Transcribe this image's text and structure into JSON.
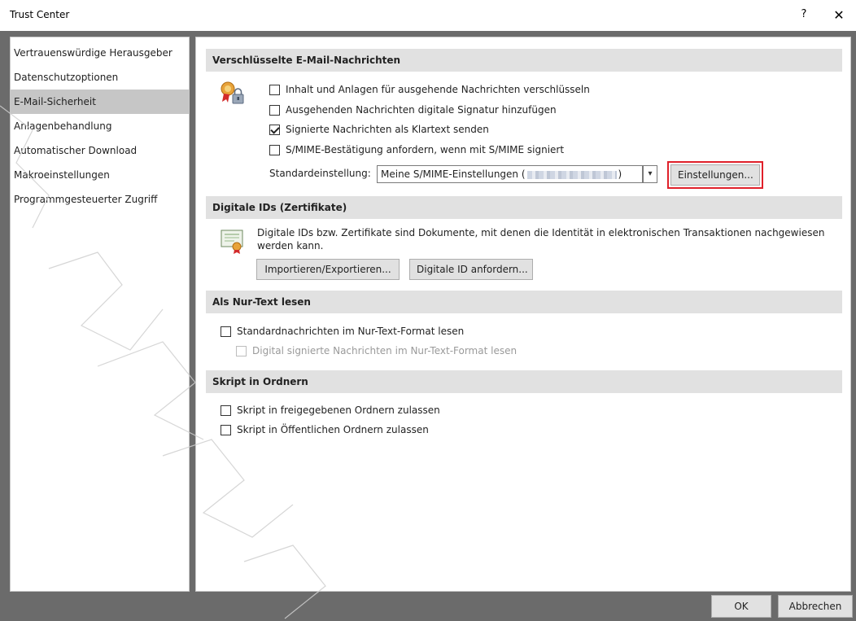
{
  "window": {
    "title": "Trust Center",
    "help_glyph": "?",
    "close_glyph": "✕"
  },
  "sidebar": {
    "items": [
      {
        "label": "Vertrauenswürdige Herausgeber",
        "selected": false
      },
      {
        "label": "Datenschutzoptionen",
        "selected": false
      },
      {
        "label": "E-Mail-Sicherheit",
        "selected": true
      },
      {
        "label": "Anlagenbehandlung",
        "selected": false
      },
      {
        "label": "Automatischer Download",
        "selected": false
      },
      {
        "label": "Makroeinstellungen",
        "selected": false
      },
      {
        "label": "Programmgesteuerter Zugriff",
        "selected": false
      }
    ]
  },
  "sections": {
    "encrypted": {
      "header": "Verschlüsselte E-Mail-Nachrichten",
      "options": [
        {
          "label": "Inhalt und Anlagen für ausgehende Nachrichten verschlüsseln",
          "checked": false
        },
        {
          "label": "Ausgehenden Nachrichten digitale Signatur hinzufügen",
          "checked": false
        },
        {
          "label": "Signierte Nachrichten als Klartext senden",
          "checked": true
        },
        {
          "label": "S/MIME-Bestätigung anfordern, wenn mit S/MIME signiert",
          "checked": false
        }
      ],
      "default_label": "Standardeinstellung:",
      "default_value_prefix": "Meine S/MIME-Einstellungen (",
      "default_value_suffix": ")",
      "settings_button": "Einstellungen..."
    },
    "digital_ids": {
      "header": "Digitale IDs (Zertifikate)",
      "description_line1": "Digitale IDs bzw. Zertifikate sind Dokumente, mit denen die Identität in elektronischen Transaktionen nachgewiesen",
      "description_line2": "werden kann.",
      "import_button": "Importieren/Exportieren...",
      "request_button": "Digitale ID anfordern..."
    },
    "plain_text": {
      "header": "Als Nur-Text lesen",
      "options": [
        {
          "label": "Standardnachrichten im Nur-Text-Format lesen",
          "checked": false,
          "disabled": false
        },
        {
          "label": "Digital signierte Nachrichten im Nur-Text-Format lesen",
          "checked": false,
          "disabled": true
        }
      ]
    },
    "scripts": {
      "header": "Skript in Ordnern",
      "options": [
        {
          "label": "Skript in freigegebenen Ordnern zulassen",
          "checked": false
        },
        {
          "label": "Skript in Öffentlichen Ordnern zulassen",
          "checked": false
        }
      ]
    }
  },
  "footer": {
    "ok": "OK",
    "cancel": "Abbrechen"
  },
  "icons": {
    "security": "ribbon-lock-icon",
    "certificate": "certificate-icon"
  },
  "colors": {
    "selected_bg": "#c6c6c6",
    "section_bg": "#e1e1e1",
    "frame_bg": "#6b6b6b",
    "highlight": "#e0202a"
  }
}
